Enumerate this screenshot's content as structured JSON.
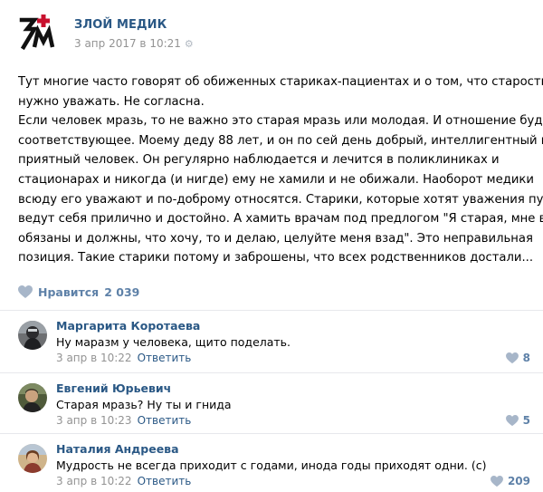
{
  "post": {
    "group_name": "ЗЛОЙ МЕДИК",
    "date": "3 апр 2017 в 10:21",
    "text_lines": [
      "Тут многие часто говорят об обиженных стариках-пациентах и о том, что старость",
      "нужно уважать. Не согласна.",
      "Если человек мразь, то не важно это старая мразь или молодая. И отношение будет",
      "соответствующее. Моему деду 88 лет, и он по сей день добрый, интеллигентный и",
      "приятный человек. Он регулярно наблюдается и лечится в поликлиниках и",
      "стационарах и никогда (и нигде) ему не хамили и не обижали. Наоборот медики",
      "всюду его уважают и по-доброму относятся. Старики, которые хотят уважения пусть",
      "ведут себя прилично и достойно. А хамить врачам под предлогом \"Я старая, мне все",
      "обязаны и должны, что хочу, то и делаю, целуйте меня взад\". Это неправильная",
      "позиция. Такие старики потому и заброшены, что всех родственников достали..."
    ],
    "likes_label": "Нравится",
    "likes_count": "2 039"
  },
  "comments": [
    {
      "author": "Маргарита Коротаева",
      "text": "Ну маразм у человека, щито поделать.",
      "date": "3 апр в 10:22",
      "reply_label": "Ответить",
      "likes": "8"
    },
    {
      "author": "Евгений Юрьевич",
      "text": "Старая мразь? Ну ты и гнида",
      "date": "3 апр в 10:23",
      "reply_label": "Ответить",
      "likes": "5"
    },
    {
      "author": "Наталия Андреева",
      "text": "Мудрость не всегда приходит с годами, инода годы приходят одни. (с)",
      "date": "3 апр в 10:22",
      "reply_label": "Ответить",
      "likes": "209"
    }
  ],
  "colors": {
    "link": "#2a5885",
    "meta": "#939393",
    "like": "#5e81a8",
    "logo_red": "#c8102e"
  }
}
